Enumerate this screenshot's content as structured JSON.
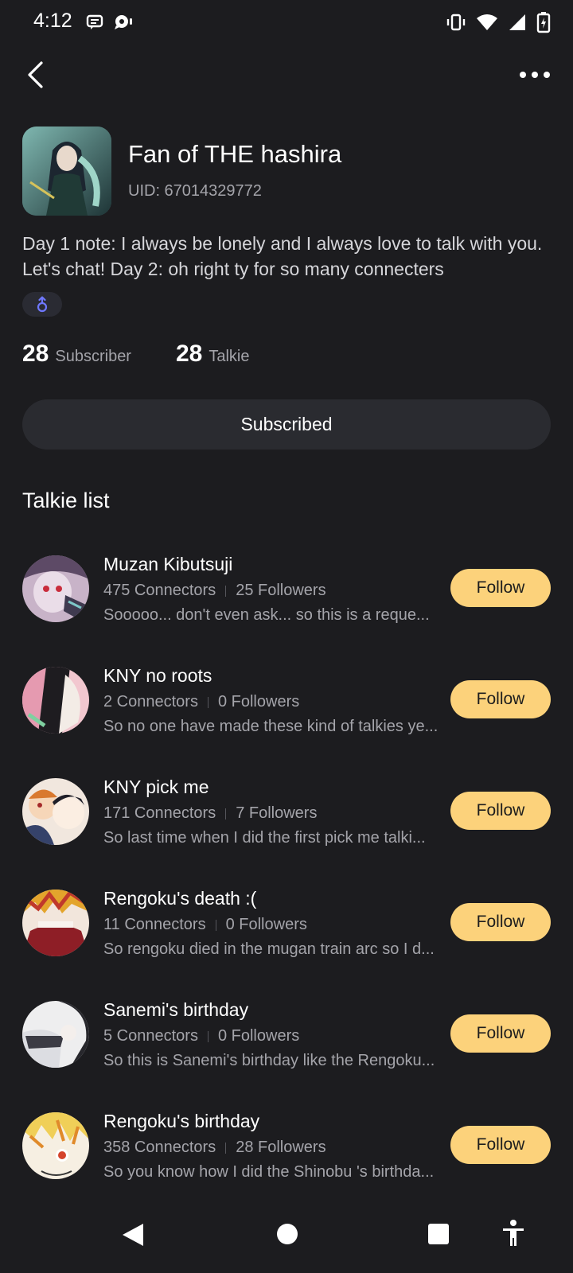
{
  "status_bar": {
    "time": "4:12"
  },
  "profile": {
    "name": "Fan of THE hashira",
    "uid": "UID: 67014329772",
    "bio": "Day 1 note: I always be lonely and I always love to talk with you. Let's chat! Day 2: oh right ty for so many connecters",
    "subscriber_count": "28",
    "subscriber_label": "Subscriber",
    "talkie_count": "28",
    "talkie_label": "Talkie",
    "subscribed_label": "Subscribed"
  },
  "section": {
    "title": "Talkie list"
  },
  "talkies": [
    {
      "name": "Muzan Kibutsuji",
      "connectors": "475 Connectors",
      "followers": "25 Followers",
      "desc": "Sooooo... don't even ask... so this is a reque...",
      "follow": "Follow"
    },
    {
      "name": "KNY no roots",
      "connectors": "2 Connectors",
      "followers": "0 Followers",
      "desc": "So no one have made these kind of talkies ye...",
      "follow": "Follow"
    },
    {
      "name": "KNY pick me",
      "connectors": "171 Connectors",
      "followers": "7 Followers",
      "desc": "So last time when I did the first pick me talki...",
      "follow": "Follow"
    },
    {
      "name": "Rengoku's death :(",
      "connectors": "11 Connectors",
      "followers": "0 Followers",
      "desc": "So rengoku died in the mugan train arc so I d...",
      "follow": "Follow"
    },
    {
      "name": "Sanemi's birthday",
      "connectors": "5 Connectors",
      "followers": "0 Followers",
      "desc": "So this is Sanemi's birthday like the Rengoku...",
      "follow": "Follow"
    },
    {
      "name": "Rengoku's birthday",
      "connectors": "358 Connectors",
      "followers": "28 Followers",
      "desc": "So you know how I did the Shinobu 's birthda...",
      "follow": "Follow"
    }
  ],
  "colors": {
    "background": "#1c1c1f",
    "follow_button": "#fcd27b",
    "subscribed_button": "#2a2b30",
    "gender_badge_icon": "#6f78ff"
  },
  "icons": {
    "back": "chevron-left-icon",
    "more": "more-horizontal-icon",
    "gender": "gender-icon"
  }
}
